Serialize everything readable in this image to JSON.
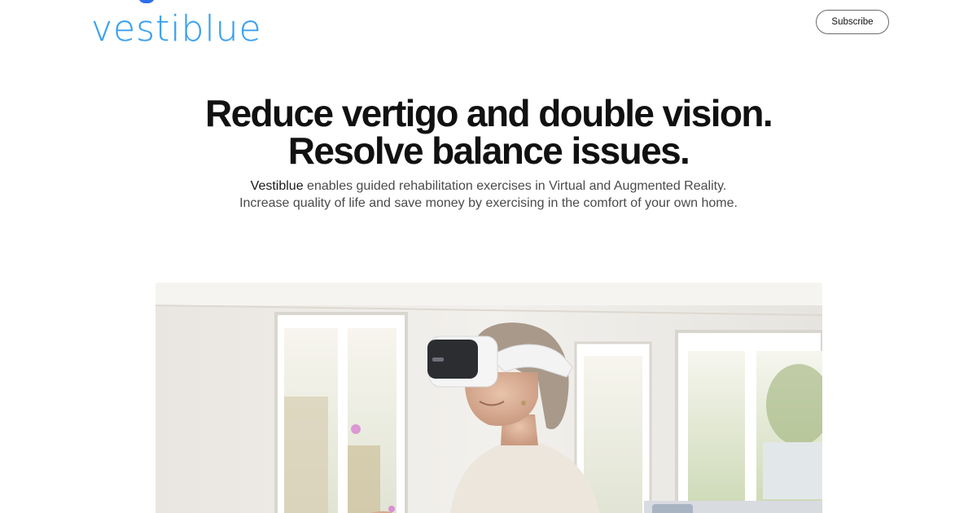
{
  "header": {
    "logo_text": "vestiblue",
    "subscribe_label": "Subscribe"
  },
  "hero_text": {
    "headline_line1": "Reduce vertigo and double vision.",
    "headline_line2": "Resolve balance issues.",
    "lead_brand": "Vestiblue",
    "lead_rest": " enables guided rehabilitation exercises in Virtual and Augmented Reality. Increase quality of life and save money by exercising in the comfort of your own home."
  },
  "hero_image": {
    "alt": "Woman wearing a white VR headset in a bright living room"
  },
  "colors": {
    "brand_blue": "#3aa0f0",
    "brand_dot": "#2f6df0",
    "text_dark": "#111111",
    "text_body": "#4a4a4a"
  }
}
